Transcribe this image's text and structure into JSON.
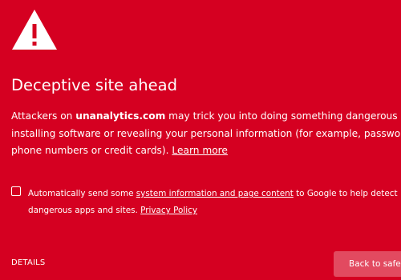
{
  "icon": {
    "name": "warning-triangle-icon",
    "color": "#ffffff",
    "glyph_color": "#d50021"
  },
  "page": {
    "background": "#d50021",
    "heading": "Deceptive site ahead"
  },
  "body": {
    "prefix": "Attackers on ",
    "domain": "unanalytics.com",
    "suffix_line1": " may trick you into doing something dangerous like",
    "line2": "installing software or revealing your personal information (for example, passwords,",
    "line3": "phone numbers or credit cards). ",
    "learn_more": "Learn more"
  },
  "checkbox": {
    "checked": false,
    "text_before": "Automatically send some ",
    "link": "system information and page content",
    "text_after": " to Google to help detect",
    "line2": "dangerous apps and sites. ",
    "privacy_policy": "Privacy Policy"
  },
  "footer": {
    "details_label": "DETAILS",
    "back_label": "Back to safety",
    "back_button_color": "#e24a60"
  }
}
